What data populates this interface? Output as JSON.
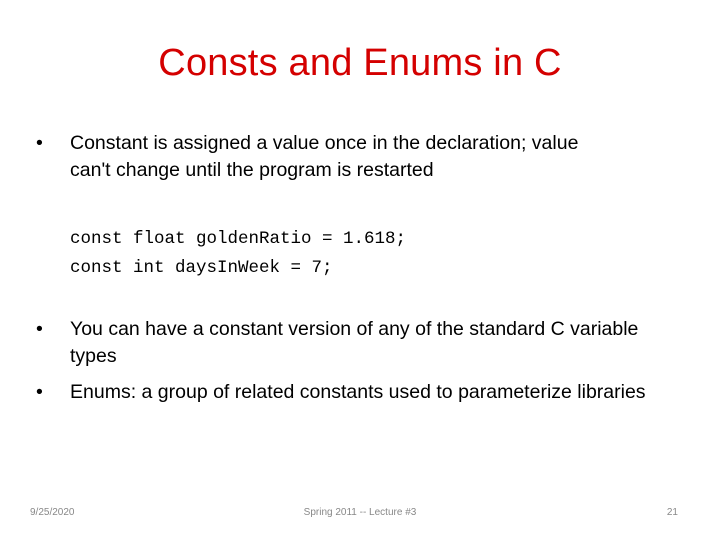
{
  "slide": {
    "title": "Consts and Enums in C",
    "title_color": "#d40000",
    "bullet_glyph": "•",
    "bullets": [
      {
        "text": "Constant is assigned a value once in the declaration; value can't change until the program is restarted"
      },
      {
        "text": "You can have a constant version of any of the standard C variable types"
      },
      {
        "text": "Enums: a group of related constants used to parameterize libraries"
      }
    ],
    "code_lines": [
      "const float goldenRatio = 1.618;",
      "const int daysInWeek = 7;"
    ]
  },
  "footer": {
    "date": "9/25/2020",
    "center": "Spring 2011 -- Lecture #3",
    "page_number": "21"
  }
}
